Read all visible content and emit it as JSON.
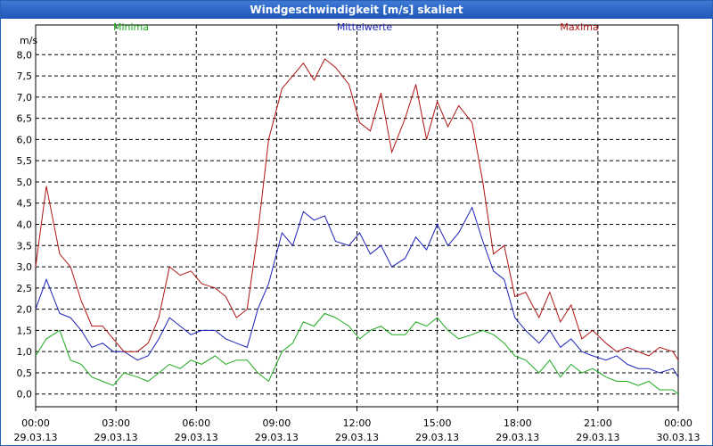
{
  "window": {
    "title": "Windgeschwindigkeit [m/s] skaliert"
  },
  "chart_data": {
    "type": "line",
    "title": "Windgeschwindigkeit [m/s] skaliert",
    "ylabel": "m/s",
    "ylim": [
      -0.3,
      8.7
    ],
    "yticks": [
      "0,0",
      "0,5",
      "1,0",
      "1,5",
      "2,0",
      "2,5",
      "3,0",
      "3,5",
      "4,0",
      "4,5",
      "5,0",
      "5,5",
      "6,0",
      "6,5",
      "7,0",
      "7,5",
      "8,0"
    ],
    "xticks": [
      {
        "time": "00:00",
        "date": "29.03.13"
      },
      {
        "time": "03:00",
        "date": "29.03.13"
      },
      {
        "time": "06:00",
        "date": "29.03.13"
      },
      {
        "time": "09:00",
        "date": "29.03.13"
      },
      {
        "time": "12:00",
        "date": "29.03.13"
      },
      {
        "time": "15:00",
        "date": "29.03.13"
      },
      {
        "time": "18:00",
        "date": "29.03.13"
      },
      {
        "time": "21:00",
        "date": "29.03.13"
      },
      {
        "time": "00:00",
        "date": "30.03.13"
      }
    ],
    "x_hours": [
      0,
      0.4,
      0.9,
      1.3,
      1.7,
      2.1,
      2.5,
      2.9,
      3.3,
      3.8,
      4.2,
      4.6,
      5.0,
      5.4,
      5.8,
      6.2,
      6.7,
      7.1,
      7.5,
      7.9,
      8.3,
      8.7,
      9.2,
      9.6,
      10.0,
      10.4,
      10.8,
      11.2,
      11.7,
      12.1,
      12.5,
      12.9,
      13.3,
      13.8,
      14.2,
      14.6,
      15.0,
      15.4,
      15.8,
      16.3,
      16.7,
      17.1,
      17.5,
      17.9,
      18.3,
      18.8,
      19.2,
      19.6,
      20.0,
      20.4,
      20.8,
      21.3,
      21.7,
      22.1,
      22.5,
      22.9,
      23.3,
      23.8,
      24.0
    ],
    "grid": true,
    "legend": "top",
    "series": [
      {
        "name": "Minima",
        "color": "#1faa1f",
        "values": [
          0.9,
          1.3,
          1.5,
          0.8,
          0.7,
          0.4,
          0.3,
          0.2,
          0.5,
          0.4,
          0.3,
          0.5,
          0.7,
          0.6,
          0.8,
          0.7,
          0.9,
          0.7,
          0.8,
          0.8,
          0.5,
          0.3,
          1.0,
          1.2,
          1.7,
          1.6,
          1.9,
          1.8,
          1.6,
          1.3,
          1.5,
          1.6,
          1.4,
          1.4,
          1.7,
          1.6,
          1.8,
          1.5,
          1.3,
          1.4,
          1.5,
          1.4,
          1.2,
          0.9,
          0.8,
          0.5,
          0.8,
          0.4,
          0.7,
          0.5,
          0.6,
          0.4,
          0.3,
          0.3,
          0.2,
          0.3,
          0.1,
          0.1,
          0.0
        ]
      },
      {
        "name": "Mittelwerte",
        "color": "#1c22b8",
        "values": [
          2.0,
          2.7,
          1.9,
          1.8,
          1.5,
          1.1,
          1.2,
          1.0,
          1.0,
          0.8,
          0.9,
          1.3,
          1.8,
          1.6,
          1.4,
          1.5,
          1.5,
          1.3,
          1.2,
          1.1,
          2.0,
          2.6,
          3.8,
          3.5,
          4.3,
          4.1,
          4.2,
          3.6,
          3.5,
          3.8,
          3.3,
          3.5,
          3.0,
          3.2,
          3.7,
          3.4,
          4.0,
          3.5,
          3.8,
          4.4,
          3.6,
          2.9,
          2.7,
          1.8,
          1.5,
          1.2,
          1.5,
          1.1,
          1.3,
          1.0,
          0.9,
          0.8,
          0.9,
          0.7,
          0.6,
          0.6,
          0.5,
          0.6,
          0.4
        ]
      },
      {
        "name": "Maxima",
        "color": "#b01414",
        "values": [
          3.0,
          4.9,
          3.3,
          3.0,
          2.2,
          1.6,
          1.6,
          1.3,
          1.0,
          1.0,
          1.2,
          1.8,
          3.0,
          2.8,
          2.9,
          2.6,
          2.5,
          2.3,
          1.8,
          2.0,
          3.8,
          6.0,
          7.2,
          7.5,
          7.8,
          7.4,
          7.9,
          7.7,
          7.3,
          6.4,
          6.2,
          7.1,
          5.7,
          6.5,
          7.3,
          6.0,
          6.9,
          6.3,
          6.8,
          6.4,
          5.0,
          3.3,
          3.5,
          2.3,
          2.4,
          1.8,
          2.4,
          1.7,
          2.1,
          1.3,
          1.5,
          1.2,
          1.0,
          1.1,
          1.0,
          0.9,
          1.1,
          1.0,
          0.8
        ]
      }
    ]
  }
}
